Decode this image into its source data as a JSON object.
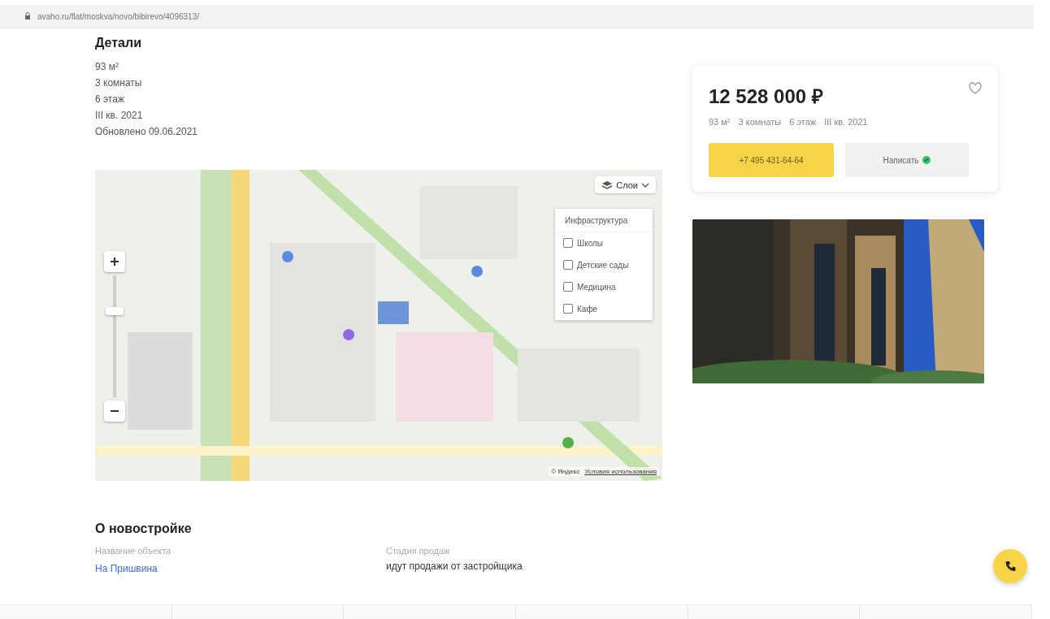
{
  "address_bar": {
    "url": "avaho.ru/flat/moskva/novo/bibirevo/4096313/"
  },
  "details": {
    "title": "Детали",
    "items": [
      "93 м²",
      "3 комнаты",
      "6 этаж",
      "III кв. 2021",
      "Обновлено 09.06.2021"
    ]
  },
  "map": {
    "layers_button": "Слои",
    "zoom": {
      "level": 0.72
    },
    "layers_menu": {
      "title": "Инфраструктура",
      "options": [
        {
          "label": "Школы",
          "checked": false
        },
        {
          "label": "Детские сады",
          "checked": false
        },
        {
          "label": "Медицина",
          "checked": false
        },
        {
          "label": "Кафе",
          "checked": false
        }
      ]
    },
    "attribution": "© Яндекс",
    "terms_link": "Условия использования"
  },
  "price_card": {
    "price": "12 528 000 ₽",
    "favorite": false,
    "summary": [
      "93 м²",
      "3 комнаты",
      "6 этаж",
      "III кв. 2021"
    ],
    "phone_button": "+7 495 431-64-64",
    "message_button": "Написать"
  },
  "about": {
    "title": "О новостройке",
    "fields": [
      {
        "label": "Название объекта",
        "value": "На Пришвина",
        "kind": "link"
      },
      {
        "label": "Стадия продаж",
        "value": "идут продажи от застройщика",
        "kind": "text"
      }
    ]
  }
}
